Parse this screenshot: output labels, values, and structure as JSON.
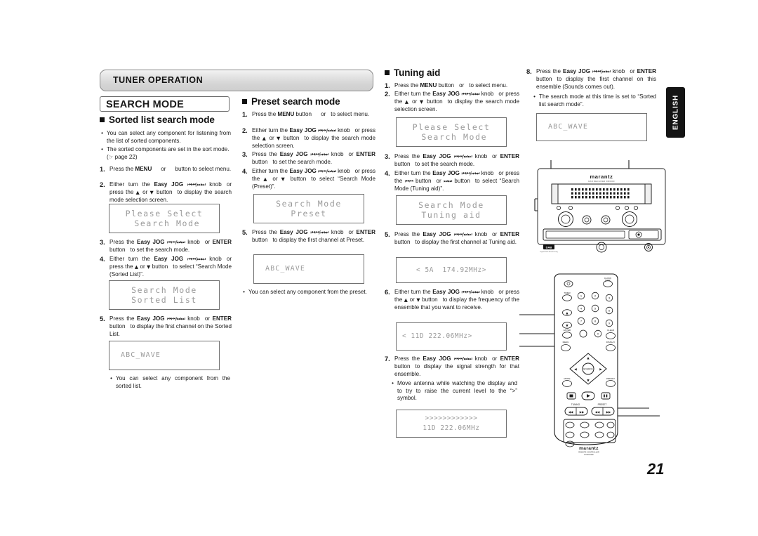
{
  "page": {
    "number": "21",
    "side_tab": "ENGLISH"
  },
  "header": {
    "section_bar": "TUNER OPERATION",
    "title_box": "SEARCH MODE"
  },
  "columns": {
    "sorted_list": {
      "heading": "Sorted list search mode",
      "notes": [
        "You can select any component for listening from the list of sorted components.",
        "The sorted components are set in the sort mode. (☞ page 22)"
      ],
      "note_page_ref": "page 22",
      "steps": [
        {
          "num": "1.",
          "parts": [
            "Press the ",
            "MENU",
            " ",
            "or",
            " button to select menu."
          ]
        },
        {
          "num": "2.",
          "parts": [
            "Either turn the ",
            "Easy JOG",
            " ⏮/⏭ knob ",
            "or",
            " press the ▲ or ▼ button ",
            "to display the search mode selection screen."
          ]
        },
        {
          "num": "3.",
          "parts": [
            "Press the ",
            "Easy JOG",
            " ⏮/⏭ knob ",
            "or",
            " ",
            "ENTER",
            " button ",
            "to set the search mode."
          ]
        },
        {
          "num": "4.",
          "parts": [
            "Either turn the ",
            "Easy JOG",
            " ⏮/⏭ knob ",
            "or",
            " press the ▲ or ▼ button ",
            "to select “Search Mode (Sorted List)”."
          ]
        },
        {
          "num": "5.",
          "parts": [
            "Press the ",
            "Easy JOG",
            " ⏮/⏭ knob ",
            "or",
            " ",
            "ENTER",
            " button ",
            "to display the first channel on the Sorted List."
          ]
        }
      ],
      "lcd1": [
        "Please Select",
        " Search Mode"
      ],
      "lcd2": [
        "Search Mode",
        "Sorted List"
      ],
      "lcd3": [
        "ABC_WAVE"
      ],
      "footnote": "You can select any component from the sorted list."
    },
    "preset": {
      "heading": "Preset search mode",
      "steps": [
        {
          "num": "1.",
          "parts": [
            "Press the ",
            "MENU",
            " button ",
            "or",
            " to select menu."
          ]
        },
        {
          "num": "2.",
          "parts": [
            "Either turn the ",
            "Easy JOG",
            " ⏮/⏭ knob ",
            "or",
            " press the ▲ or ▼ button ",
            "to display the search mode selection screen."
          ]
        },
        {
          "num": "3.",
          "parts": [
            "Press the ",
            "Easy JOG",
            " ⏮/⏭ knob ",
            "or",
            " ",
            "ENTER",
            " button ",
            "to set the search mode."
          ]
        },
        {
          "num": "4.",
          "parts": [
            "Either turn the ",
            "Easy JOG",
            " ⏮/⏭ knob ",
            "or",
            " press the ▲ or ▼ button ",
            "to select “Search Mode (Preset)”."
          ]
        },
        {
          "num": "5.",
          "parts": [
            "Press the ",
            "Easy JOG",
            " ⏮/⏭ knob ",
            "or",
            " ",
            "ENTER",
            " button ",
            "to display the first channel at Preset."
          ]
        }
      ],
      "lcd1": [
        "Search Mode",
        "Preset"
      ],
      "lcd2": [
        "ABC_WAVE"
      ],
      "footnote": "You can select any component from the preset."
    },
    "tuning_aid": {
      "heading": "Tuning aid",
      "steps": [
        {
          "num": "1.",
          "parts": [
            "Press the ",
            "MENU",
            " button ",
            "or",
            " to select menu."
          ]
        },
        {
          "num": "2.",
          "parts": [
            "Either turn the ",
            "Easy JOG",
            " ⏮/⏭ knob ",
            "or",
            " press the ▲ or ▼ button ",
            "to display the search mode selection screen."
          ]
        },
        {
          "num": "3.",
          "parts": [
            "Press the ",
            "Easy JOG",
            " ⏮/⏭ knob ",
            "or",
            " ",
            "ENTER",
            " button ",
            "to set the search mode."
          ]
        },
        {
          "num": "4.",
          "parts": [
            "Either turn the ",
            "Easy JOG",
            " ⏮/⏭ knob ",
            "or",
            " press the ⏮ button ",
            "or",
            " ⏭ button ",
            "to select “Search Mode (Tuning aid)”."
          ]
        },
        {
          "num": "5.",
          "parts": [
            "Press the ",
            "Easy JOG",
            " ⏮/⏭ knob ",
            "or",
            " ",
            "ENTER",
            " button ",
            "to display the first channel at Tuning aid."
          ]
        },
        {
          "num": "6.",
          "parts": [
            "Either turn the ",
            "Easy JOG",
            " ⏮/⏭ knob ",
            "or",
            " press the ▲ or ▼ button ",
            "to display the frequency of the ensemble that you want to receive."
          ]
        },
        {
          "num": "7.",
          "parts": [
            "Press the ",
            "Easy JOG",
            " ⏮/⏭ knob ",
            "or",
            " ",
            "ENTER",
            " button ",
            "to display the signal strength for that ensemble."
          ]
        }
      ],
      "lcd1": [
        "Please Select",
        " Search Mode"
      ],
      "lcd2": [
        "Search Mode",
        "Tuning aid"
      ],
      "lcd3": [
        "< 5A  174.92MHz>"
      ],
      "lcd4": [
        "< 11D 222.06MHz>"
      ],
      "lcd5": [
        ">>>>>>>>>>>>",
        "11D 222.06MHz"
      ],
      "footnote": "Move antenna while watching the display and to try to raise the current level to the “>” symbol."
    },
    "final": {
      "steps": [
        {
          "num": "8.",
          "parts": [
            "Press the ",
            "Easy JOG",
            " ⏮/⏭ knob ",
            "or",
            " ",
            "ENTER",
            " button ",
            "to display the first channel on this ensemble (Sounds comes out)."
          ]
        }
      ],
      "footnote": "The search mode at this time is set to “Sorted list search mode”.",
      "lcd1": [
        "ABC_WAVE"
      ]
    }
  },
  "illustrations": {
    "receiver": {
      "name": "marantz-receiver-front-panel",
      "brand": "marantz",
      "brand_sub": "DAB RECEIVER DR6000",
      "badge": "DAB",
      "badge_sub": "Digital Audio Broadcasting"
    },
    "remote": {
      "name": "marantz-remote-control",
      "brand": "marantz",
      "brand_sub_1": "REMOTE CONTROLLER",
      "brand_sub_2": "RC6001DR",
      "labels": {
        "clock_disp": "CLOCK/DISP",
        "timer": "TIMER",
        "enter": "ENTER",
        "clear": "CLEAR",
        "menu": "MENU",
        "display": "DISPLAY",
        "mode": "MODE",
        "preset_r": "PRESET",
        "tuning": "TUNING",
        "preset": "PRESET",
        "mute": "MUTE"
      },
      "keypad": [
        "1",
        "2",
        "3",
        "4",
        "5",
        "6",
        "7",
        "8",
        "9",
        "0"
      ]
    }
  },
  "colors": {
    "ink": "#1a1a1a",
    "lcd_text": "#9a9a9a",
    "bar_fill": "#dcdcdc",
    "tab_bg": "#141414"
  }
}
